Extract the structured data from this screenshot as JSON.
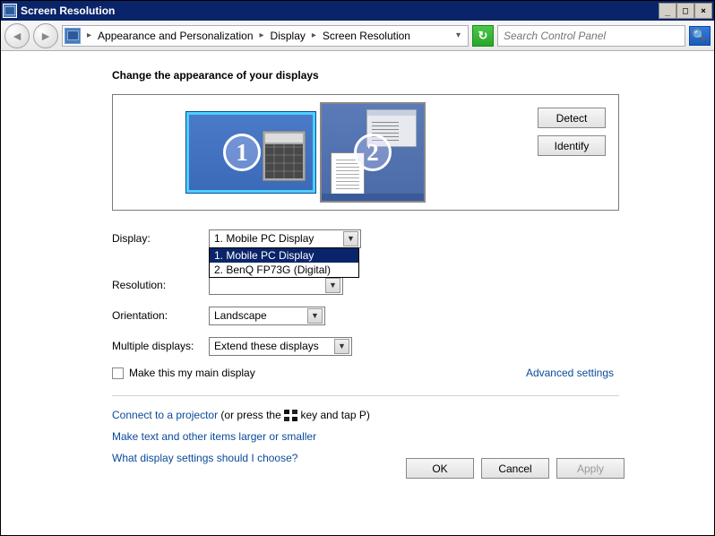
{
  "titlebar": {
    "title": "Screen Resolution"
  },
  "breadcrumb": {
    "items": [
      "Appearance and Personalization",
      "Display",
      "Screen Resolution"
    ]
  },
  "search": {
    "placeholder": "Search Control Panel"
  },
  "heading": "Change the appearance of your displays",
  "preview": {
    "monitor1_num": "1",
    "monitor2_num": "2",
    "detect": "Detect",
    "identify": "Identify"
  },
  "form": {
    "display_label": "Display:",
    "display_value": "1. Mobile PC Display",
    "display_options": [
      "1. Mobile PC Display",
      "2. BenQ FP73G (Digital)"
    ],
    "resolution_label": "Resolution:",
    "orientation_label": "Orientation:",
    "orientation_value": "Landscape",
    "multiple_label": "Multiple displays:",
    "multiple_value": "Extend these displays",
    "maindisplay_label": "Make this my main display",
    "advanced": "Advanced settings"
  },
  "links": {
    "projector_a": "Connect to a projector",
    "projector_b": " (or press the ",
    "projector_c": " key and tap P)",
    "textsize": "Make text and other items larger or smaller",
    "whatsettings": "What display settings should I choose?"
  },
  "buttons": {
    "ok": "OK",
    "cancel": "Cancel",
    "apply": "Apply"
  }
}
